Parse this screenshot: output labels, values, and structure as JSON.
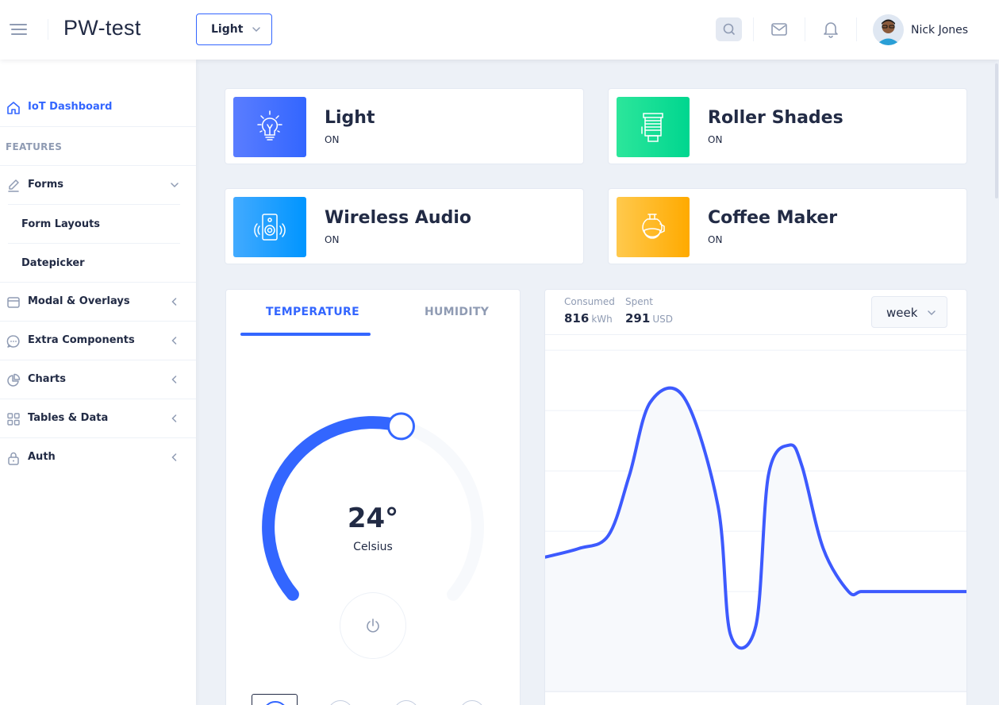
{
  "header": {
    "title": "PW-test",
    "theme_value": "Light",
    "user_name": "Nick Jones"
  },
  "sidebar": {
    "dashboard": "IoT Dashboard",
    "group": "FEATURES",
    "items": [
      {
        "label": "Forms",
        "icon": "edit-icon",
        "expanded": true
      },
      {
        "label": "Form Layouts"
      },
      {
        "label": "Datepicker"
      },
      {
        "label": "Modal & Overlays",
        "icon": "browser-icon"
      },
      {
        "label": "Extra Components",
        "icon": "message-circle-icon"
      },
      {
        "label": "Charts",
        "icon": "pie-chart-icon"
      },
      {
        "label": "Tables & Data",
        "icon": "grid-icon"
      },
      {
        "label": "Auth",
        "icon": "lock-icon"
      }
    ]
  },
  "devices": [
    {
      "name": "Light",
      "status": "ON",
      "icon": "lightbulb-icon",
      "color": "#3366ff"
    },
    {
      "name": "Roller Shades",
      "status": "ON",
      "icon": "roller-shades-icon",
      "color": "#00d68f"
    },
    {
      "name": "Wireless Audio",
      "status": "ON",
      "icon": "speaker-icon",
      "color": "#0095ff"
    },
    {
      "name": "Coffee Maker",
      "status": "ON",
      "icon": "coffee-maker-icon",
      "color": "#ffaa00"
    }
  ],
  "thermostat": {
    "tabs": [
      "TEMPERATURE",
      "HUMIDITY"
    ],
    "active_tab": "TEMPERATURE",
    "value": "24°",
    "unit": "Celsius",
    "level": 0.56,
    "accent": "#3366ff"
  },
  "electricity": {
    "consumed_label": "Consumed",
    "consumed_value": "816",
    "consumed_unit": "kWh",
    "spent_label": "Spent",
    "spent_value": "291",
    "spent_unit": "USD",
    "period": "week",
    "line_color": "#3d5afe"
  },
  "chart_data": {
    "type": "line",
    "title": "",
    "xlabel": "",
    "ylabel": "",
    "x": [
      0,
      0.08,
      0.15,
      0.2,
      0.25,
      0.33,
      0.41,
      0.44,
      0.5,
      0.53,
      0.58,
      0.61,
      0.66,
      0.72,
      0.75,
      0.8,
      0.84,
      0.9,
      1.0
    ],
    "values": [
      2.4,
      2.6,
      2.9,
      4.3,
      6.0,
      6.1,
      3.6,
      0.6,
      0.8,
      4.3,
      5.0,
      4.5,
      2.6,
      1.6,
      1.6,
      1.6,
      1.6,
      1.6,
      1.6
    ],
    "ylim": [
      0,
      7
    ],
    "grid": true
  }
}
